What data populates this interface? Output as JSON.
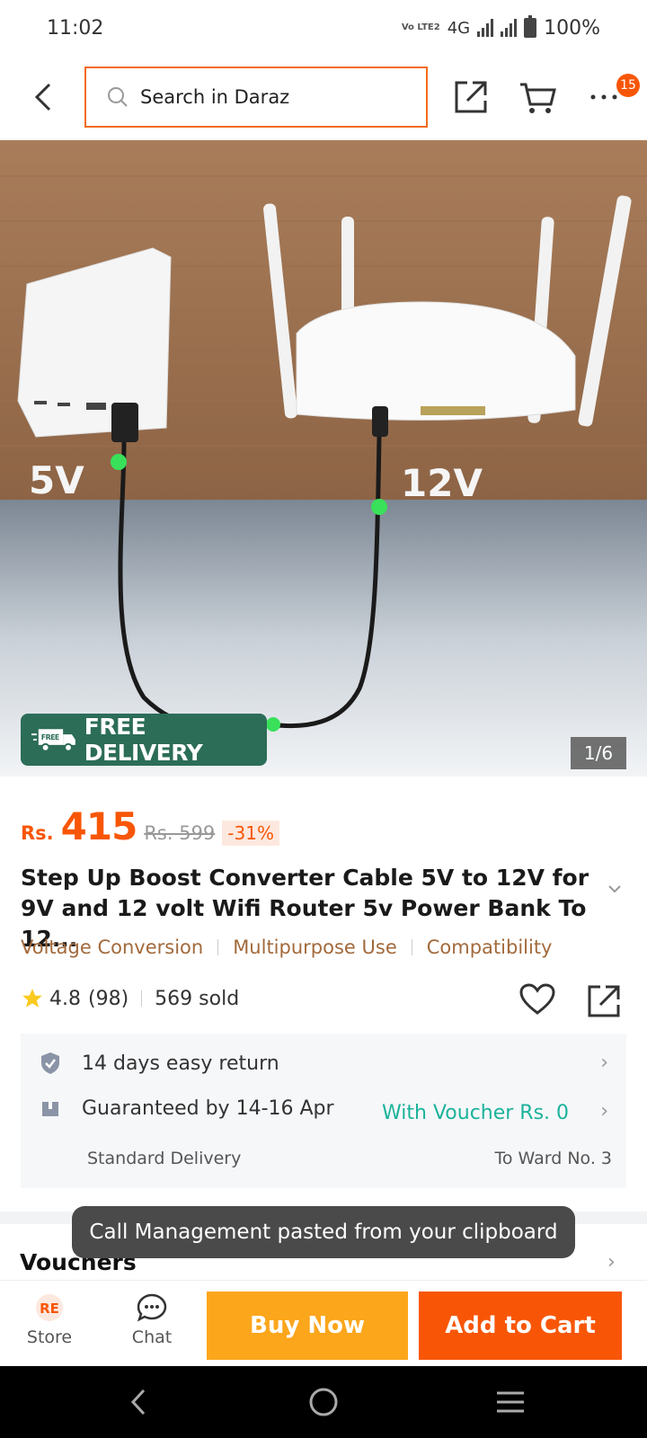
{
  "status_bar": {
    "time": "11:02",
    "volte": "Vo LTE2",
    "network": "4G",
    "battery": "100%"
  },
  "header": {
    "search_placeholder": "Search in Daraz",
    "cart_badge": "15"
  },
  "hero": {
    "badge_label": "FREE DELIVERY",
    "badge_small": "FREE",
    "image_counter": "1/6",
    "label_left": "5V",
    "label_right": "12V"
  },
  "product": {
    "currency": "Rs.",
    "price": "415",
    "old_price": "Rs. 599",
    "discount": "-31%",
    "title": "Step Up Boost Converter Cable 5V to 12V for 9V and 12 volt Wifi Router 5v Power Bank To 12...",
    "tags": [
      "Voltage Conversion",
      "Multipurpose Use",
      "Compatibility"
    ],
    "rating": "4.8",
    "reviews": "(98)",
    "sold": "569 sold"
  },
  "service": {
    "return_text": "14 days easy return",
    "delivery_text": "Guaranteed by 14-16 Apr",
    "voucher_text": "With Voucher Rs. 0",
    "delivery_type": "Standard Delivery",
    "ward": "To Ward No. 3"
  },
  "vouchers_label": "Vouchers",
  "toast": "Call Management pasted from your clipboard",
  "bottom_bar": {
    "store": "Store",
    "store_logo": "RE",
    "chat": "Chat",
    "buy_now": "Buy Now",
    "add_to_cart": "Add to Cart"
  },
  "colors": {
    "accent": "#f85606",
    "buy": "#fca61b",
    "free_delivery": "#2c6d58",
    "voucher_green": "#1bb39b",
    "tag_brown": "#a26a3c"
  }
}
